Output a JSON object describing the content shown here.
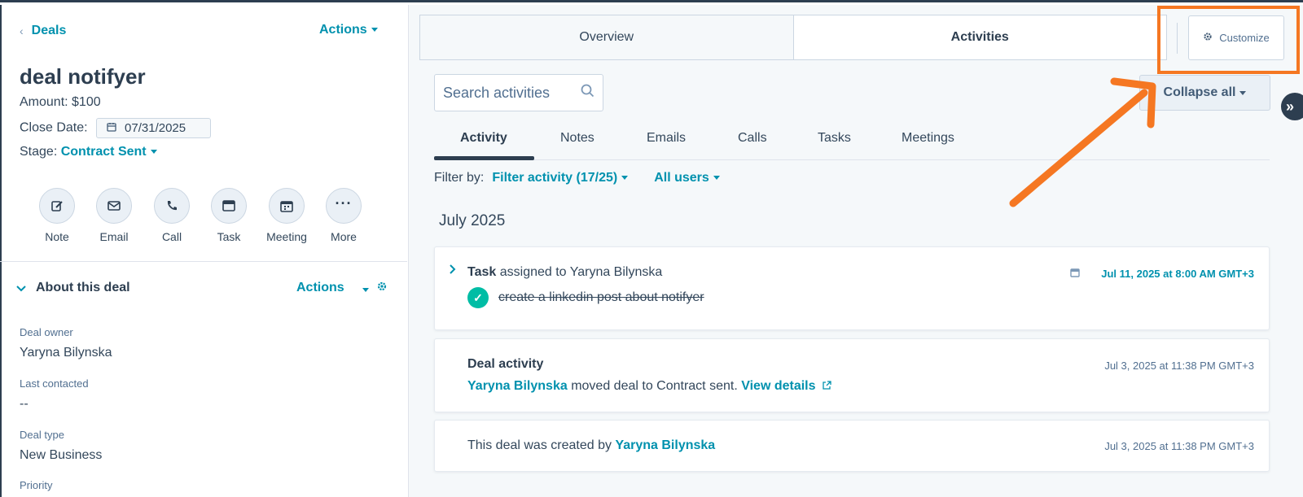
{
  "sidebar": {
    "back_label": "Deals",
    "actions_label": "Actions",
    "deal_name": "deal notifyer",
    "amount_text": "Amount: $100",
    "close_date_label": "Close Date:",
    "close_date_value": "07/31/2025",
    "stage_label": "Stage:",
    "stage_value": "Contract Sent",
    "quick_actions": [
      {
        "label": "Note",
        "icon": "note-edit-icon"
      },
      {
        "label": "Email",
        "icon": "email-icon"
      },
      {
        "label": "Call",
        "icon": "phone-icon"
      },
      {
        "label": "Task",
        "icon": "task-icon"
      },
      {
        "label": "Meeting",
        "icon": "calendar-icon"
      },
      {
        "label": "More",
        "icon": "more-dots-icon"
      }
    ],
    "about_title": "About this deal",
    "about_actions_label": "Actions",
    "properties": [
      {
        "label": "Deal owner",
        "value": "Yaryna Bilynska"
      },
      {
        "label": "Last contacted",
        "value": "--"
      },
      {
        "label": "Deal type",
        "value": "New Business"
      },
      {
        "label": "Priority",
        "value": ""
      }
    ]
  },
  "main": {
    "tabs": [
      {
        "label": "Overview",
        "active": false
      },
      {
        "label": "Activities",
        "active": true
      }
    ],
    "customize_label": "Customize",
    "search_placeholder": "Search activities",
    "collapse_label": "Collapse all",
    "subtabs": [
      "Activity",
      "Notes",
      "Emails",
      "Calls",
      "Tasks",
      "Meetings"
    ],
    "active_subtab": "Activity",
    "filter_prefix": "Filter by:",
    "filter_activity": "Filter activity (17/25)",
    "filter_users": "All users",
    "month_heading": "July 2025",
    "activities": [
      {
        "type": "Task",
        "title_bold": "Task",
        "title_rest": "assigned to Yaryna Bilynska",
        "task_text": "create a linkedin post about notifyer",
        "timestamp": "Jul 11, 2025 at 8:00 AM GMT+3"
      },
      {
        "type": "Deal activity",
        "title_bold": "Deal activity",
        "actor": "Yaryna Bilynska",
        "action_text": "moved deal to Contract sent.",
        "link_text": "View details",
        "timestamp": "Jul 3, 2025 at 11:38 PM GMT+3"
      },
      {
        "type": "Creation",
        "prefix_text": "This deal was created by",
        "actor": "Yaryna Bilynska",
        "timestamp": "Jul 3, 2025 at 11:38 PM GMT+3"
      }
    ]
  },
  "colors": {
    "accent": "#0091ae",
    "highlight": "#f57722",
    "success": "#00bda5",
    "dark": "#2d3e50"
  }
}
